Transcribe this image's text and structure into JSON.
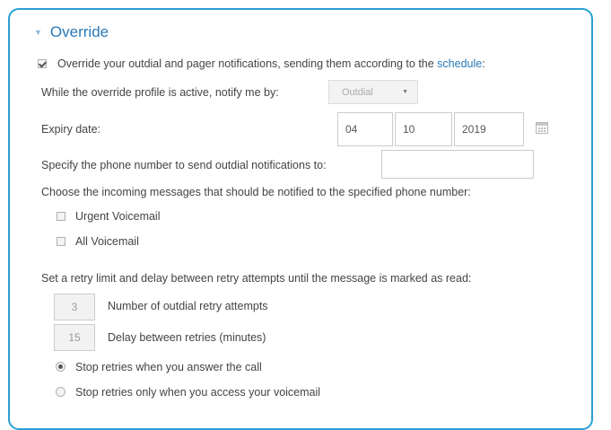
{
  "colors": {
    "accent": "#2a9fd6",
    "link": "#2a7ab8"
  },
  "section": {
    "title": "Override",
    "caret_icon": "triangle-down-icon"
  },
  "override": {
    "checked": true,
    "label": "Override your outdial and pager notifications, sending them according to the ",
    "link": "schedule",
    "suffix": ":"
  },
  "notify": {
    "label": "While the override profile is active, notify me by:",
    "selected": "Outdial"
  },
  "expiry": {
    "label": "Expiry date:",
    "month": "04",
    "day": "10",
    "year": "2019",
    "calendar_icon": "calendar-icon"
  },
  "phone": {
    "label": "Specify the phone number to send outdial notifications to:",
    "value": ""
  },
  "messages": {
    "label": "Choose the incoming messages that should be notified to the specified phone number:",
    "options": [
      {
        "label": "Urgent Voicemail",
        "checked": false
      },
      {
        "label": "All Voicemail",
        "checked": false
      }
    ]
  },
  "retry": {
    "label": "Set a retry limit and delay between retry attempts until the message is marked as read:",
    "attempts_value": "3",
    "attempts_label": "Number of outdial retry attempts",
    "delay_value": "15",
    "delay_label": "Delay between retries (minutes)",
    "stop_options": [
      {
        "label": "Stop retries when you answer the call",
        "checked": true
      },
      {
        "label": "Stop retries only when you access your voicemail",
        "checked": false
      }
    ]
  }
}
